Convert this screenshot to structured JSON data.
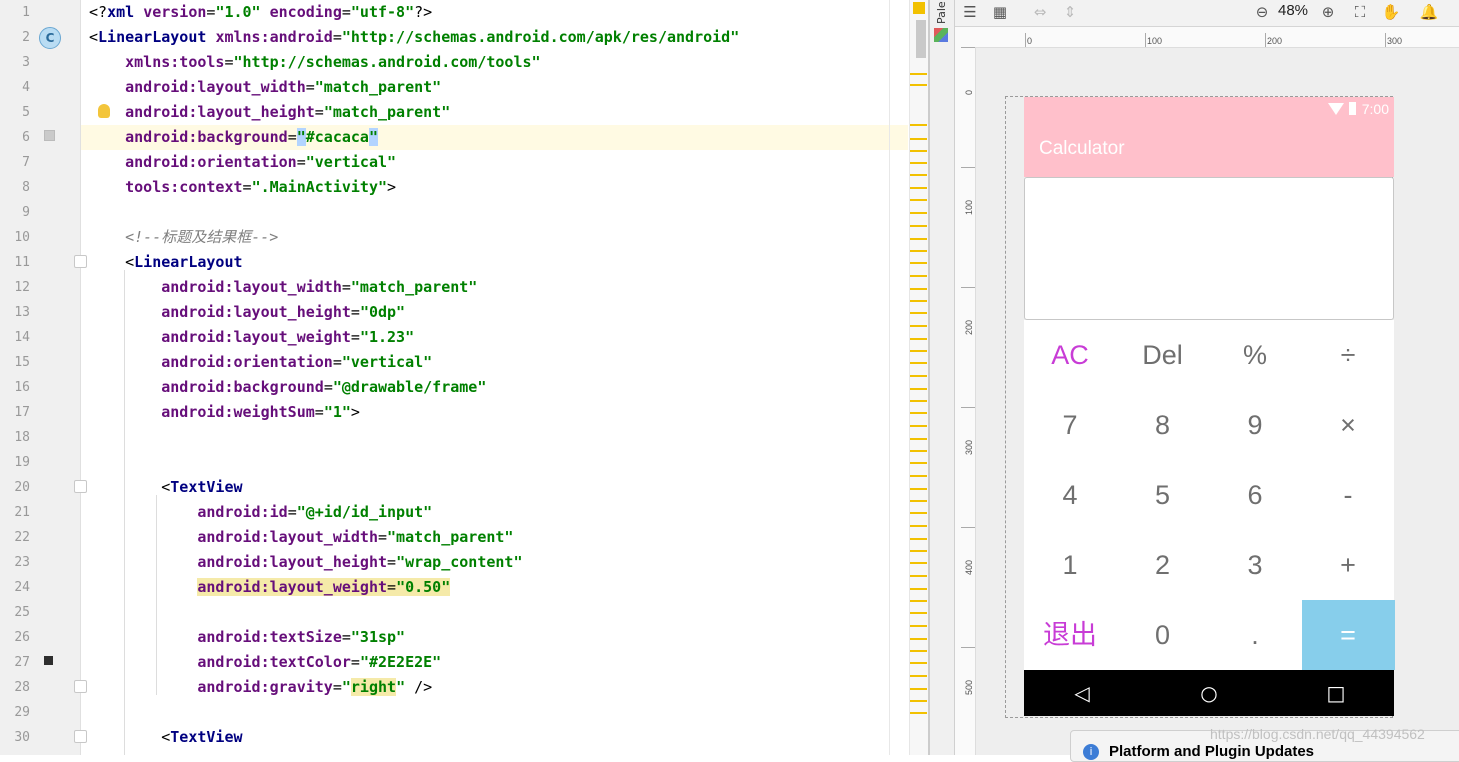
{
  "editor": {
    "lines": [
      {
        "n": "1",
        "tokens": [
          [
            "p",
            "<?"
          ],
          [
            "t",
            "xml "
          ],
          [
            "a",
            "version"
          ],
          [
            "p",
            "="
          ],
          [
            "v",
            "\"1.0\""
          ],
          [
            "p",
            " "
          ],
          [
            "a",
            "encoding"
          ],
          [
            "p",
            "="
          ],
          [
            "v",
            "\"utf-8\""
          ],
          [
            "p",
            "?>"
          ]
        ]
      },
      {
        "n": "2",
        "tokens": [
          [
            "p",
            "<"
          ],
          [
            "t",
            "LinearLayout "
          ],
          [
            "ns",
            "xmlns:android"
          ],
          [
            "p",
            "="
          ],
          [
            "v",
            "\"http://schemas.android.com/apk/res/android\""
          ]
        ]
      },
      {
        "n": "3",
        "tokens": [
          [
            "p",
            "    "
          ],
          [
            "ns",
            "xmlns:tools"
          ],
          [
            "p",
            "="
          ],
          [
            "v",
            "\"http://schemas.android.com/tools\""
          ]
        ]
      },
      {
        "n": "4",
        "tokens": [
          [
            "p",
            "    "
          ],
          [
            "a",
            "android:layout_width"
          ],
          [
            "p",
            "="
          ],
          [
            "v",
            "\"match_parent\""
          ]
        ]
      },
      {
        "n": "5",
        "tokens": [
          [
            "p",
            "    "
          ],
          [
            "a",
            "android:layout_height"
          ],
          [
            "p",
            "="
          ],
          [
            "v",
            "\"match_parent\""
          ]
        ]
      },
      {
        "n": "6",
        "tokens": [
          [
            "p",
            "    "
          ],
          [
            "a",
            "android:background"
          ],
          [
            "p",
            "="
          ],
          [
            "sel",
            "\""
          ],
          [
            "v",
            "#cacaca"
          ],
          [
            "sel",
            "\""
          ]
        ]
      },
      {
        "n": "7",
        "tokens": [
          [
            "p",
            "    "
          ],
          [
            "a",
            "android:orientation"
          ],
          [
            "p",
            "="
          ],
          [
            "v",
            "\"vertical\""
          ]
        ]
      },
      {
        "n": "8",
        "tokens": [
          [
            "p",
            "    "
          ],
          [
            "a",
            "tools:context"
          ],
          [
            "p",
            "="
          ],
          [
            "v",
            "\".MainActivity\""
          ],
          [
            "p",
            ">"
          ]
        ]
      },
      {
        "n": "9",
        "tokens": []
      },
      {
        "n": "10",
        "tokens": [
          [
            "p",
            "    "
          ],
          [
            "c",
            "<!--标题及结果框-->"
          ]
        ]
      },
      {
        "n": "11",
        "tokens": [
          [
            "p",
            "    <"
          ],
          [
            "t",
            "LinearLayout"
          ]
        ]
      },
      {
        "n": "12",
        "tokens": [
          [
            "p",
            "        "
          ],
          [
            "a",
            "android:layout_width"
          ],
          [
            "p",
            "="
          ],
          [
            "v",
            "\"match_parent\""
          ]
        ]
      },
      {
        "n": "13",
        "tokens": [
          [
            "p",
            "        "
          ],
          [
            "a",
            "android:layout_height"
          ],
          [
            "p",
            "="
          ],
          [
            "v",
            "\"0dp\""
          ]
        ]
      },
      {
        "n": "14",
        "tokens": [
          [
            "p",
            "        "
          ],
          [
            "a",
            "android:layout_weight"
          ],
          [
            "p",
            "="
          ],
          [
            "v",
            "\"1.23\""
          ]
        ]
      },
      {
        "n": "15",
        "tokens": [
          [
            "p",
            "        "
          ],
          [
            "a",
            "android:orientation"
          ],
          [
            "p",
            "="
          ],
          [
            "v",
            "\"vertical\""
          ]
        ]
      },
      {
        "n": "16",
        "tokens": [
          [
            "p",
            "        "
          ],
          [
            "a",
            "android:background"
          ],
          [
            "p",
            "="
          ],
          [
            "v",
            "\"@drawable/frame\""
          ]
        ]
      },
      {
        "n": "17",
        "tokens": [
          [
            "p",
            "        "
          ],
          [
            "a",
            "android:weightSum"
          ],
          [
            "p",
            "="
          ],
          [
            "v",
            "\"1\""
          ],
          [
            "p",
            ">"
          ]
        ]
      },
      {
        "n": "18",
        "tokens": []
      },
      {
        "n": "19",
        "tokens": []
      },
      {
        "n": "20",
        "tokens": [
          [
            "p",
            "        <"
          ],
          [
            "t",
            "TextView"
          ]
        ]
      },
      {
        "n": "21",
        "tokens": [
          [
            "p",
            "            "
          ],
          [
            "a",
            "android:id"
          ],
          [
            "p",
            "="
          ],
          [
            "v",
            "\"@+id/id_input\""
          ]
        ]
      },
      {
        "n": "22",
        "tokens": [
          [
            "p",
            "            "
          ],
          [
            "a",
            "android:layout_width"
          ],
          [
            "p",
            "="
          ],
          [
            "v",
            "\"match_parent\""
          ]
        ]
      },
      {
        "n": "23",
        "tokens": [
          [
            "p",
            "            "
          ],
          [
            "a",
            "android:layout_height"
          ],
          [
            "p",
            "="
          ],
          [
            "v",
            "\"wrap_content\""
          ]
        ]
      },
      {
        "n": "24",
        "tokens": [
          [
            "p",
            "            "
          ],
          [
            "hla",
            "android:layout_weight"
          ],
          [
            "hlp",
            "="
          ],
          [
            "hlv",
            "\"0.50\""
          ]
        ]
      },
      {
        "n": "25",
        "tokens": []
      },
      {
        "n": "26",
        "tokens": [
          [
            "p",
            "            "
          ],
          [
            "a",
            "android:textSize"
          ],
          [
            "p",
            "="
          ],
          [
            "v",
            "\"31sp\""
          ]
        ]
      },
      {
        "n": "27",
        "tokens": [
          [
            "p",
            "            "
          ],
          [
            "a",
            "android:textColor"
          ],
          [
            "p",
            "="
          ],
          [
            "v",
            "\"#2E2E2E\""
          ]
        ]
      },
      {
        "n": "28",
        "tokens": [
          [
            "p",
            "            "
          ],
          [
            "a",
            "android:gravity"
          ],
          [
            "p",
            "="
          ],
          [
            "v",
            "\""
          ],
          [
            "hlv",
            "right"
          ],
          [
            "v",
            "\""
          ],
          [
            "p",
            " />"
          ]
        ]
      },
      {
        "n": "29",
        "tokens": []
      },
      {
        "n": "30",
        "tokens": [
          [
            "p",
            "        <"
          ],
          [
            "t",
            "TextView"
          ]
        ]
      }
    ]
  },
  "palette_label": "Pale",
  "toolbar": {
    "zoom": "48%"
  },
  "ruler": {
    "h": [
      "0",
      "100",
      "200",
      "300"
    ],
    "v": [
      "0",
      "100",
      "200",
      "300",
      "400",
      "500"
    ]
  },
  "phone": {
    "time": "7:00",
    "title": "Calculator",
    "keys": [
      [
        "AC",
        "Del",
        "%",
        "÷"
      ],
      [
        "7",
        "8",
        "9",
        "×"
      ],
      [
        "4",
        "5",
        "6",
        "-"
      ],
      [
        "1",
        "2",
        "3",
        "+"
      ],
      [
        "退出",
        "0",
        ".",
        "="
      ]
    ]
  },
  "notification": "Platform and Plugin Updates",
  "watermark": "https://blog.csdn.net/qq_44394562",
  "colors": {
    "appbar": "#ffc0cb",
    "equals": "#87ceeb",
    "accent": "#c83cd6"
  }
}
